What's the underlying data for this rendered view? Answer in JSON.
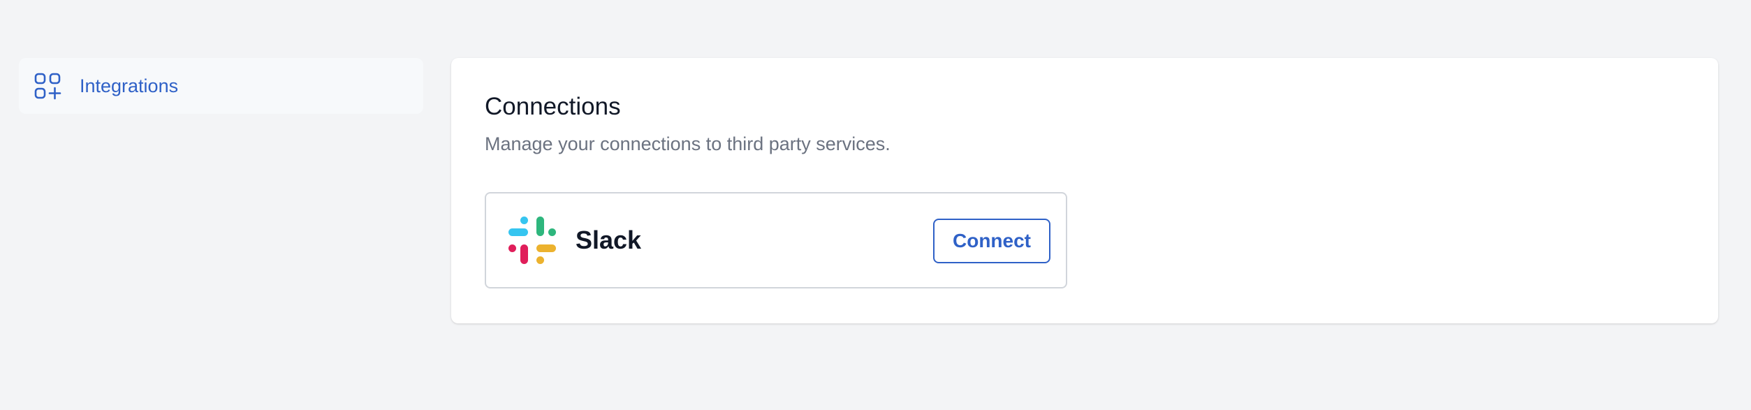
{
  "sidebar": {
    "items": [
      {
        "label": "Integrations",
        "icon": "integrations-icon",
        "active": true
      }
    ]
  },
  "main": {
    "title": "Connections",
    "subtitle": "Manage your connections to third party services.",
    "connections": [
      {
        "name": "Slack",
        "icon": "slack-logo-icon",
        "action_label": "Connect"
      }
    ]
  },
  "colors": {
    "accent": "#2f61c7",
    "background": "#f3f4f6",
    "panel": "#ffffff",
    "text_primary": "#111827",
    "text_secondary": "#6b7280"
  }
}
